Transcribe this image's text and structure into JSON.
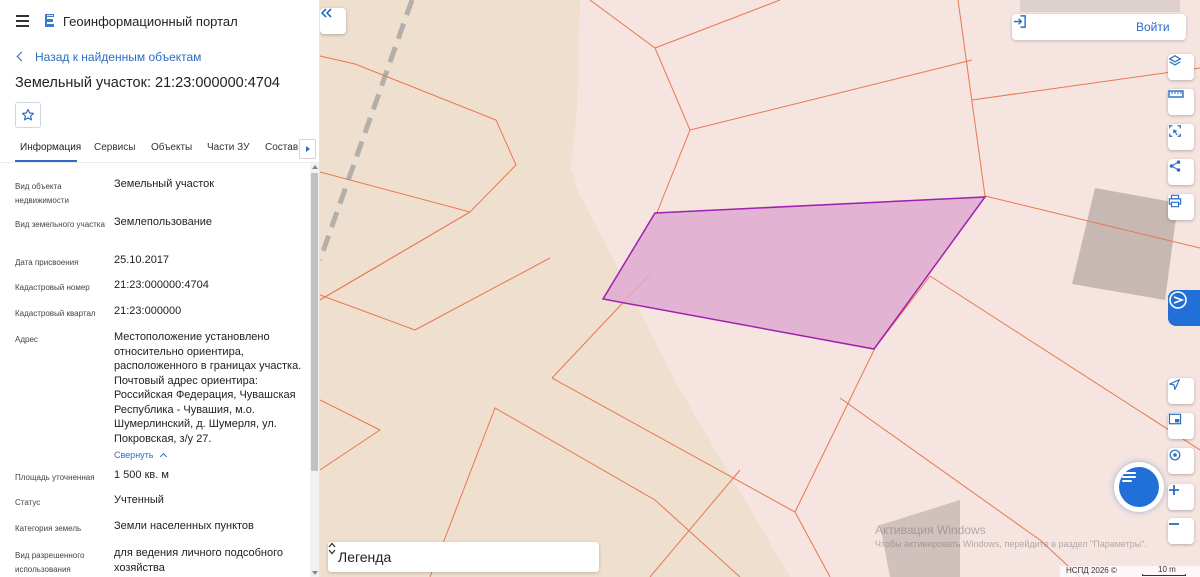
{
  "app": {
    "title": "Геоинформационный портал"
  },
  "nav": {
    "back_label": "Назад к найденным объектам"
  },
  "object": {
    "title": "Земельный участок: 21:23:000000:4704"
  },
  "tabs": [
    {
      "label": "Информация"
    },
    {
      "label": "Сервисы"
    },
    {
      "label": "Объекты"
    },
    {
      "label": "Части ЗУ"
    },
    {
      "label": "Состав"
    }
  ],
  "info": [
    {
      "label": "Вид объекта недвижимости",
      "value": "Земельный участок"
    },
    {
      "label": "Вид земельного участка",
      "value": "Землепользование"
    },
    {
      "label": "Дата присвоения",
      "value": "25.10.2017"
    },
    {
      "label": "Кадастровый номер",
      "value": "21:23:000000:4704"
    },
    {
      "label": "Кадастровый квартал",
      "value": "21:23:000000"
    },
    {
      "label": "Адрес",
      "value": "Местоположение установлено относительно ориентира, расположенного в границах участка. Почтовый адрес ориентира: Российская Федерация, Чувашская Республика - Чувашия, м.о. Шумерлинский, д. Шумерля, ул. Покровская, з/у 27."
    },
    {
      "label": "Площадь уточненная",
      "value": "1 500 кв. м"
    },
    {
      "label": "Статус",
      "value": "Учтенный"
    },
    {
      "label": "Категория земель",
      "value": "Земли населенных пунктов"
    },
    {
      "label": "Вид разрешенного использования",
      "value": "для ведения личного подсобного хозяйства"
    }
  ],
  "collapse_label": "Свернуть",
  "map": {
    "login_label": "Войти",
    "legend_label": "Легенда",
    "attribution": "НСПД 2026 ©",
    "scale": "10 m",
    "watermark_title": "Активация Windows",
    "watermark_text": "Чтобы активировать Windows, перейдите в раздел \"Параметры\".",
    "toolbar": [
      "layers-icon",
      "ruler-icon",
      "select-area-icon",
      "share-icon",
      "print-icon"
    ],
    "controls": [
      "locate-icon",
      "minimap-icon",
      "gps-icon",
      "zoom-in-icon",
      "zoom-out-icon"
    ]
  },
  "colors": {
    "accent": "#2b6cc4",
    "parcel_fill": "#dfaad0",
    "parcel_stroke": "#a020b0",
    "boundary": "#e87850",
    "land_light": "#f4e4dc",
    "land_dark": "#efdfcf"
  }
}
